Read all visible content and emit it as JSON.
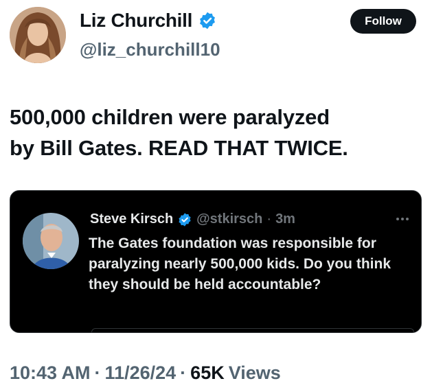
{
  "author": {
    "display_name": "Liz Churchill",
    "handle": "@liz_churchill10",
    "avatar_icon": "user-avatar-woman",
    "verified_icon": "verified-badge-icon",
    "verified_color": "#1d9bf0"
  },
  "actions": {
    "follow_label": "Follow"
  },
  "tweet": {
    "line1": "500,000 children were paralyzed",
    "line2": "by Bill Gates. READ THAT TWICE."
  },
  "quote": {
    "display_name": "Steve Kirsch",
    "handle": "@stkirsch",
    "separator": "·",
    "time": "3m",
    "text": "The Gates foundation was responsible for paralyzing nearly 500,000 kids.  Do you think they should be held accountable?",
    "avatar_icon": "user-avatar-man",
    "more_icon": "more-options-icon"
  },
  "meta": {
    "time": "10:43 AM",
    "sep1": "·",
    "date": "11/26/24",
    "sep2": "·",
    "views_count": "65K",
    "views_label": "Views"
  },
  "colors": {
    "text": "#0f1419",
    "secondary": "#536471",
    "quote_bg": "#000000",
    "quote_text": "#e7e9ea",
    "quote_secondary": "#71767b"
  }
}
